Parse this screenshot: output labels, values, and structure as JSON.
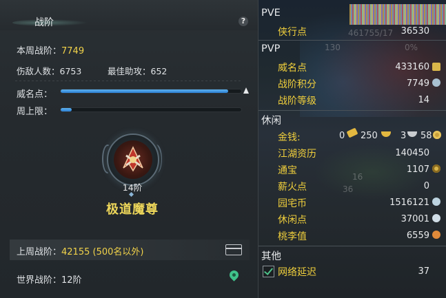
{
  "left": {
    "title": "战阶",
    "help_label": "?",
    "weekly_rank_label": "本周战阶：",
    "weekly_rank_value": "7749",
    "enemies_label": "伤敌人数：6753",
    "best_assist_label": "最佳助攻：652",
    "prestige_label": "威名点：",
    "prestige_progress": 0.92,
    "weekly_cap_label": "周上限：",
    "weekly_cap_progress": 0.06,
    "rank_level": "14阶",
    "rank_name": "极道魔尊",
    "last_week_label": "上周战阶：",
    "last_week_value": "42155 (500名以外)",
    "world_rank_label": "世界战阶：12阶"
  },
  "right": {
    "pve": {
      "header": "PVE",
      "items": [
        {
          "label": "侠行点",
          "value": "36530"
        }
      ]
    },
    "pvp": {
      "header": "PVP",
      "items": [
        {
          "label": "威名点",
          "value": "433160"
        },
        {
          "label": "战阶积分",
          "value": "7749"
        },
        {
          "label": "战阶等级",
          "value": "14"
        }
      ]
    },
    "leisure": {
      "header": "休闲",
      "money_label": "金钱:",
      "money_values": [
        "0",
        "250",
        "3",
        "58"
      ],
      "items": [
        {
          "label": "江湖资历",
          "value": "140450"
        },
        {
          "label": "通宝",
          "value": "1107"
        },
        {
          "label": "薪火点",
          "value": "0"
        },
        {
          "label": "园宅币",
          "value": "1516121"
        },
        {
          "label": "休闲点",
          "value": "37001"
        },
        {
          "label": "桃李值",
          "value": "6559"
        }
      ]
    },
    "other": {
      "header": "其他",
      "network_label": "网络延迟",
      "network_value": "37"
    },
    "background_text": [
      "461755/17",
      "130",
      "0%",
      "36",
      "16"
    ]
  },
  "colors": {
    "accent_yellow": "#f2d34a",
    "rank_name": "#eed75a",
    "progress_blue": "#2b7fd4",
    "map_pin_green": "#3fc28a"
  }
}
